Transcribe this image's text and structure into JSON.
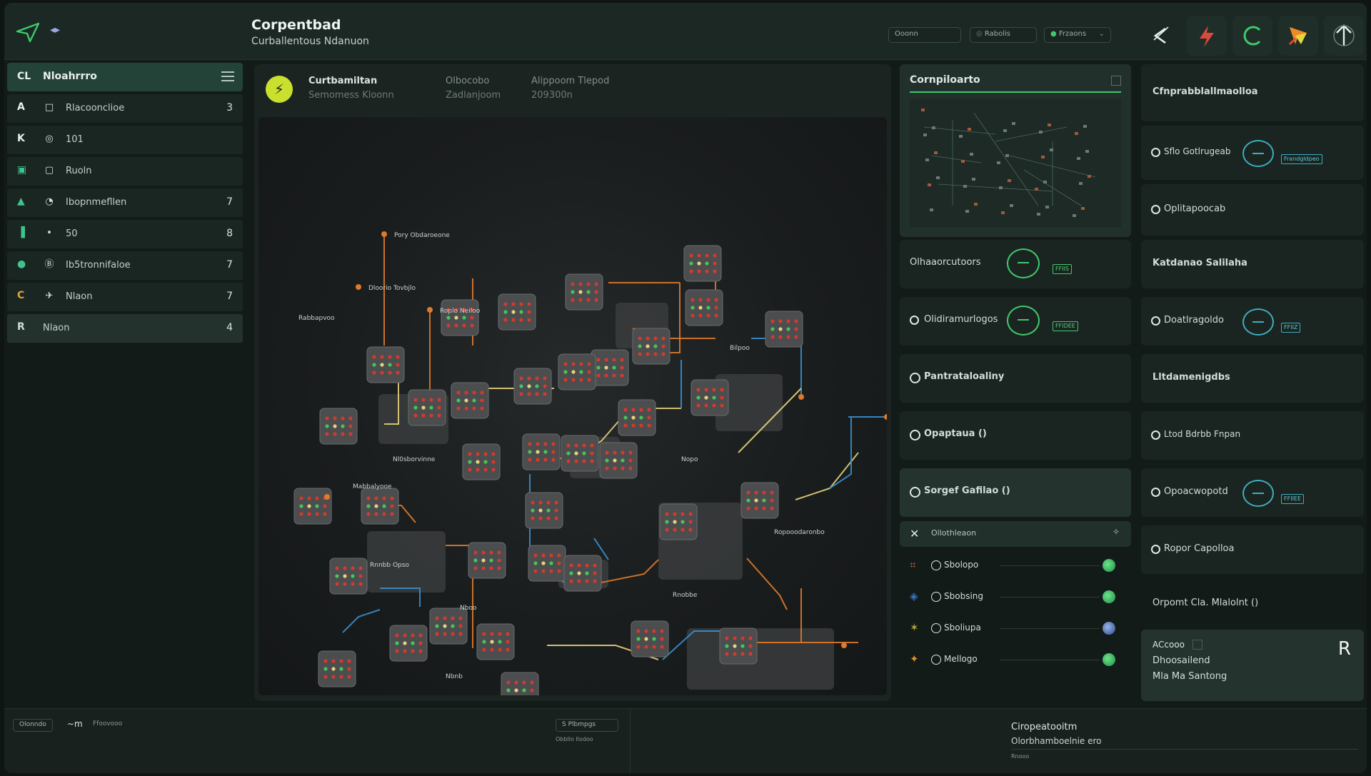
{
  "header": {
    "title": "Corpentbad",
    "subtitle": "Curballentous Ndanuon",
    "inputs": [
      "Ooonn",
      "Rabolis",
      "Frzaons"
    ],
    "logo_glyph": "◂▸"
  },
  "sidebar": {
    "key": "CL",
    "title": "Nloahrrro",
    "items": [
      {
        "icon": "A",
        "label": "Rlacoonclioe",
        "count": "3",
        "color": "#e8f0ec"
      },
      {
        "icon": "K",
        "label": "101",
        "count": "",
        "color": "#e8f0ec"
      },
      {
        "icon": "▣",
        "label": "Ruoln",
        "count": "",
        "color": "#3fc38d"
      },
      {
        "icon": "▲",
        "label": "Ibopnmefllen",
        "count": "7",
        "color": "#3fc38d"
      },
      {
        "icon": "▐",
        "label": "50",
        "count": "8",
        "color": "#3fc38d"
      },
      {
        "icon": "●",
        "label": "Ib5tronnifaloe",
        "count": "7",
        "color": "#3fc38d"
      },
      {
        "icon": "C",
        "label": "Nlaon",
        "count": "7",
        "color": "#e0a23a"
      },
      {
        "icon": "R",
        "label": "Nlaon",
        "count": "4",
        "color": "#d0dcd6"
      }
    ]
  },
  "main": {
    "head": {
      "t1": "Curtbamiltan",
      "s1": "Semomess Kloonn",
      "t2": "Olbocobo",
      "s2": "Zadlanjoom",
      "t3": "Alippoom  Tlepod",
      "s3": "209300n"
    },
    "labels": [
      {
        "text": "Pory Obdaroeone"
      },
      {
        "text": "Dloorio Tovbjlo"
      },
      {
        "text": "Roplo Neiloo"
      },
      {
        "text": "Rabbapvoo"
      },
      {
        "text": "Mabbalyooe"
      },
      {
        "text": "Nl0sborvinne"
      },
      {
        "text": "Bilpoo"
      },
      {
        "text": "Ropooodaronbo"
      },
      {
        "text": "Nbnb"
      },
      {
        "text": "Rnobbe"
      },
      {
        "text": "Nopo"
      },
      {
        "text": "Nboo"
      },
      {
        "text": "Rnnbb Opso"
      }
    ]
  },
  "compilations": {
    "title": "Cornpiloarto"
  },
  "right_mid": {
    "rows": [
      {
        "label": "Olhaaorcutoors",
        "value": "FFIIS"
      },
      {
        "label": "Olidiramurlogos",
        "value": "FFIDEE"
      },
      {
        "label": "Pantrataloaliny",
        "value": ""
      },
      {
        "label": "Opaptaua ()",
        "value": ""
      },
      {
        "label": "Sorgef Gafilao ()",
        "value": ""
      }
    ],
    "list_header": "Ollothleaon",
    "list": [
      {
        "label": "Sbolopo"
      },
      {
        "label": "Sbobsing"
      },
      {
        "label": "Sboliupa"
      },
      {
        "label": "Mellogo"
      }
    ]
  },
  "right_col": {
    "rows": [
      {
        "label": "Cfnprabblallmaolloa",
        "value": ""
      },
      {
        "label": "Sflo Gotlrugeab",
        "value": "Frandgldpeo"
      },
      {
        "label": "Oplitapoocab",
        "value": ""
      },
      {
        "label": "Katdanao Salilaha",
        "value": ""
      },
      {
        "label": "Doatlragoldo",
        "value": "FFIIZ"
      },
      {
        "label": "Lltdamenigdbs",
        "value": ""
      },
      {
        "label": "Ltod Bdrbb Fnpan",
        "value": ""
      },
      {
        "label": "Opoacwopotd",
        "value": "FFIIEE"
      },
      {
        "label": "Ropor Capolloa",
        "value": ""
      },
      {
        "label": "Orpomt Cla. Mlalolnt ()",
        "value": ""
      }
    ],
    "access": {
      "title": "ACcooo",
      "line1": "Dhoosailend",
      "line2": "Mla Ma Santong",
      "glyph": "R"
    }
  },
  "footer": {
    "tag1": "Olonndo",
    "tag1b": "Ffoovooo",
    "tag2": "S Plbmpgs",
    "tag2b": "Obbllo  Ilodoo",
    "right_title": "Ciropeatooitm",
    "right_sub": "Olorbhamboelnie ero",
    "right_small": "Rnooo"
  },
  "colors": {
    "accent": "#3ec96d",
    "accent_blue": "#3db0c2",
    "link_orange": "#e07a2a",
    "link_yellow": "#e6d27a",
    "link_blue": "#3a8fd0"
  }
}
